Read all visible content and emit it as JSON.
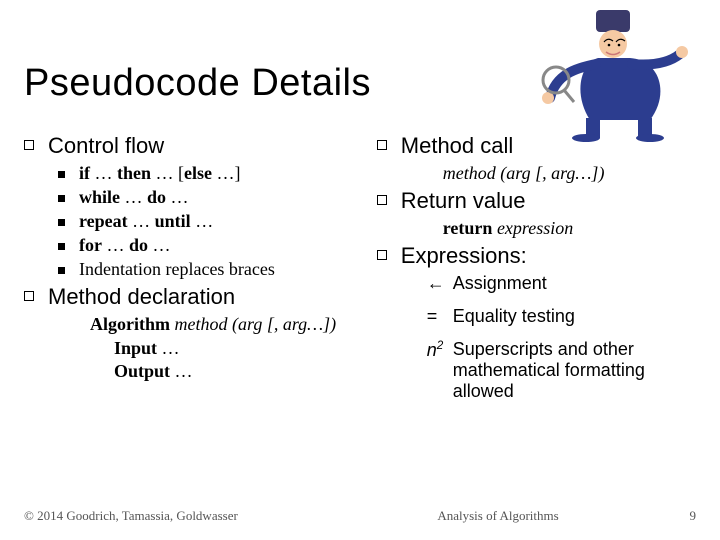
{
  "title": "Pseudocode Details",
  "left": {
    "h1": "Control flow",
    "items": {
      "ifthen": {
        "b1": "if",
        "t1": " … ",
        "b2": "then",
        "t2": " … [",
        "b3": "else",
        "t3": " …]"
      },
      "while": {
        "b1": "while",
        "t1": " … ",
        "b2": "do",
        "t2": " …"
      },
      "repeat": {
        "b1": "repeat",
        "t1": " … ",
        "b2": "until",
        "t2": " …"
      },
      "for": {
        "b1": "for",
        "t1": " … ",
        "b2": "do",
        "t2": " …"
      },
      "indent": "Indentation replaces braces"
    },
    "h2": "Method declaration",
    "decl": {
      "kw": "Algorithm ",
      "sig": "method (arg [, arg…])"
    },
    "input": {
      "b": "Input",
      "t": " …"
    },
    "output": {
      "b": "Output",
      "t": " …"
    }
  },
  "right": {
    "h1": "Method call",
    "call": "method (arg [, arg…])",
    "h2": "Return value",
    "ret": {
      "b": "return ",
      "e": "expression"
    },
    "h3": "Expressions:",
    "assign": {
      "sym": "←",
      "txt": "Assignment"
    },
    "eq": {
      "sym": "=",
      "txt": "Equality testing"
    },
    "sup": {
      "base": "n",
      "exp": "2",
      "txt": " Superscripts and other mathematical formatting allowed"
    }
  },
  "footer": {
    "left": "© 2014 Goodrich, Tamassia, Goldwasser",
    "center": "Analysis of Algorithms",
    "right": "9"
  }
}
